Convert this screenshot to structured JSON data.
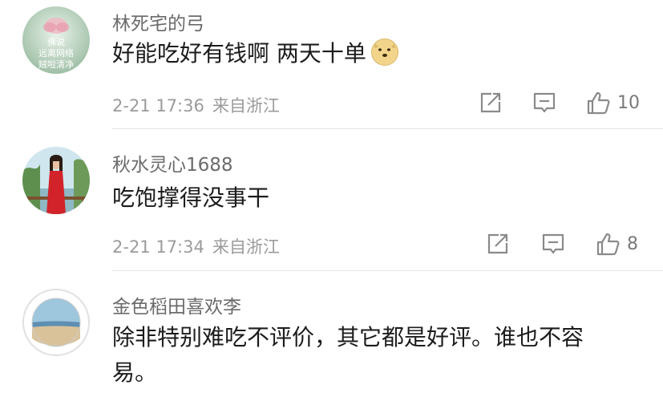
{
  "comments": [
    {
      "username": "林死宅的弓",
      "avatar_lines": [
        "佛说",
        "远离网络",
        "贼啦清净"
      ],
      "text": "好能吃好有钱啊 两天十单",
      "emoji": "doge-emoji",
      "date": "2-21 17:36",
      "location": "来自浙江",
      "likes": "10"
    },
    {
      "username": "秋水灵心1688",
      "text": "吃饱撑得没事干",
      "date": "2-21 17:34",
      "location": "来自浙江",
      "likes": "8"
    },
    {
      "username": "金色稻田喜欢李",
      "text_lines": [
        "除非特别难吃不评价，其它都是好评。谁也不容",
        "易。"
      ]
    }
  ],
  "icons": {
    "share": "share-icon",
    "reply": "reply-icon",
    "like": "thumbs-up-icon"
  },
  "colors": {
    "username": "#6b6b6b",
    "text": "#1c1c1c",
    "meta": "#9b9b9b",
    "divider": "#e6e6e6"
  }
}
